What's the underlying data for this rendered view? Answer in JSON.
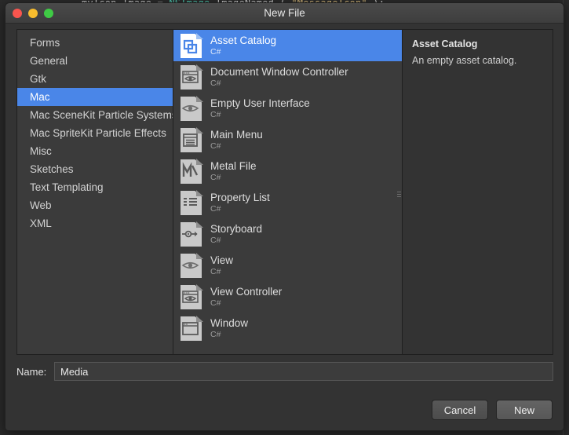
{
  "background_editor": {
    "code_line": {
      "part1": "myIcon.Image = ",
      "type": "NSImage",
      "part2": ".ImageNamed ( ",
      "string": "\"MessageIcon\"",
      "part3": " );"
    }
  },
  "window": {
    "title": "New File",
    "traffic_lights": [
      "close-button",
      "minimize-button",
      "zoom-button"
    ]
  },
  "categories": {
    "items": [
      {
        "label": "Forms",
        "selected": false
      },
      {
        "label": "General",
        "selected": false
      },
      {
        "label": "Gtk",
        "selected": false
      },
      {
        "label": "Mac",
        "selected": true
      },
      {
        "label": "Mac SceneKit Particle Systems",
        "selected": false
      },
      {
        "label": "Mac SpriteKit Particle Effects",
        "selected": false
      },
      {
        "label": "Misc",
        "selected": false
      },
      {
        "label": "Sketches",
        "selected": false
      },
      {
        "label": "Text Templating",
        "selected": false
      },
      {
        "label": "Web",
        "selected": false
      },
      {
        "label": "XML",
        "selected": false
      }
    ]
  },
  "templates": {
    "items": [
      {
        "name": "Asset Catalog",
        "lang": "C#",
        "icon": "asset-catalog-icon",
        "selected": true
      },
      {
        "name": "Document Window Controller",
        "lang": "C#",
        "icon": "window-eye-icon",
        "selected": false
      },
      {
        "name": "Empty User Interface",
        "lang": "C#",
        "icon": "eye-icon",
        "selected": false
      },
      {
        "name": "Main Menu",
        "lang": "C#",
        "icon": "menu-list-icon",
        "selected": false
      },
      {
        "name": "Metal File",
        "lang": "C#",
        "icon": "metal-m-icon",
        "selected": false
      },
      {
        "name": "Property List",
        "lang": "C#",
        "icon": "property-list-icon",
        "selected": false
      },
      {
        "name": "Storyboard",
        "lang": "C#",
        "icon": "storyboard-arrow-icon",
        "selected": false
      },
      {
        "name": "View",
        "lang": "C#",
        "icon": "eye-icon",
        "selected": false
      },
      {
        "name": "View Controller",
        "lang": "C#",
        "icon": "window-eye-icon",
        "selected": false
      },
      {
        "name": "Window",
        "lang": "C#",
        "icon": "window-icon",
        "selected": false
      }
    ]
  },
  "detail": {
    "title": "Asset Catalog",
    "description": "An empty asset catalog."
  },
  "name_field": {
    "label": "Name:",
    "value": "Media",
    "placeholder": ""
  },
  "buttons": {
    "cancel": "Cancel",
    "new": "New"
  },
  "colors": {
    "selection_blue": "#4a86e8",
    "dialog_bg": "#333333",
    "pane_bg": "#3b3b3b",
    "editor_bg": "#2b2b2b",
    "close_red": "#f9554e",
    "minimize_yellow": "#f8bd2e",
    "zoom_green": "#3fcb45"
  }
}
